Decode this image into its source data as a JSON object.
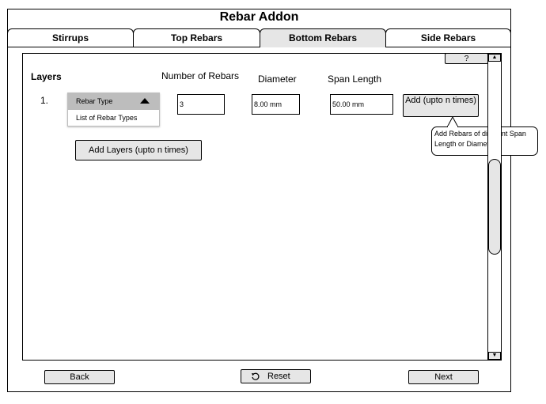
{
  "app": {
    "title": "Rebar Addon"
  },
  "tabs": [
    {
      "label": "Stirrups"
    },
    {
      "label": "Top Rebars"
    },
    {
      "label": "Bottom Rebars"
    },
    {
      "label": "Side Rebars"
    }
  ],
  "help": {
    "label": "?"
  },
  "layers": {
    "heading": "Layers",
    "columns": {
      "number": "Number of Rebars",
      "diameter": "Diameter",
      "span": "Span Length"
    },
    "rows": [
      {
        "index": "1.",
        "rebar_type": "Rebar Type",
        "rebar_type_option": "List of Rebar Types",
        "number_of_rebars": "3",
        "diameter": "8.00 mm",
        "span_length": "50.00 mm",
        "add_label": "Add (upto n times)"
      }
    ],
    "add_layers_label": "Add Layers (upto n times)"
  },
  "tooltip": {
    "text": "Add Rebars of different Span Length or Diameter"
  },
  "footer": {
    "back": "Back",
    "reset": "Reset",
    "next": "Next"
  },
  "scrollbar": {
    "up_arrow": "▲",
    "down_arrow": "▼"
  }
}
